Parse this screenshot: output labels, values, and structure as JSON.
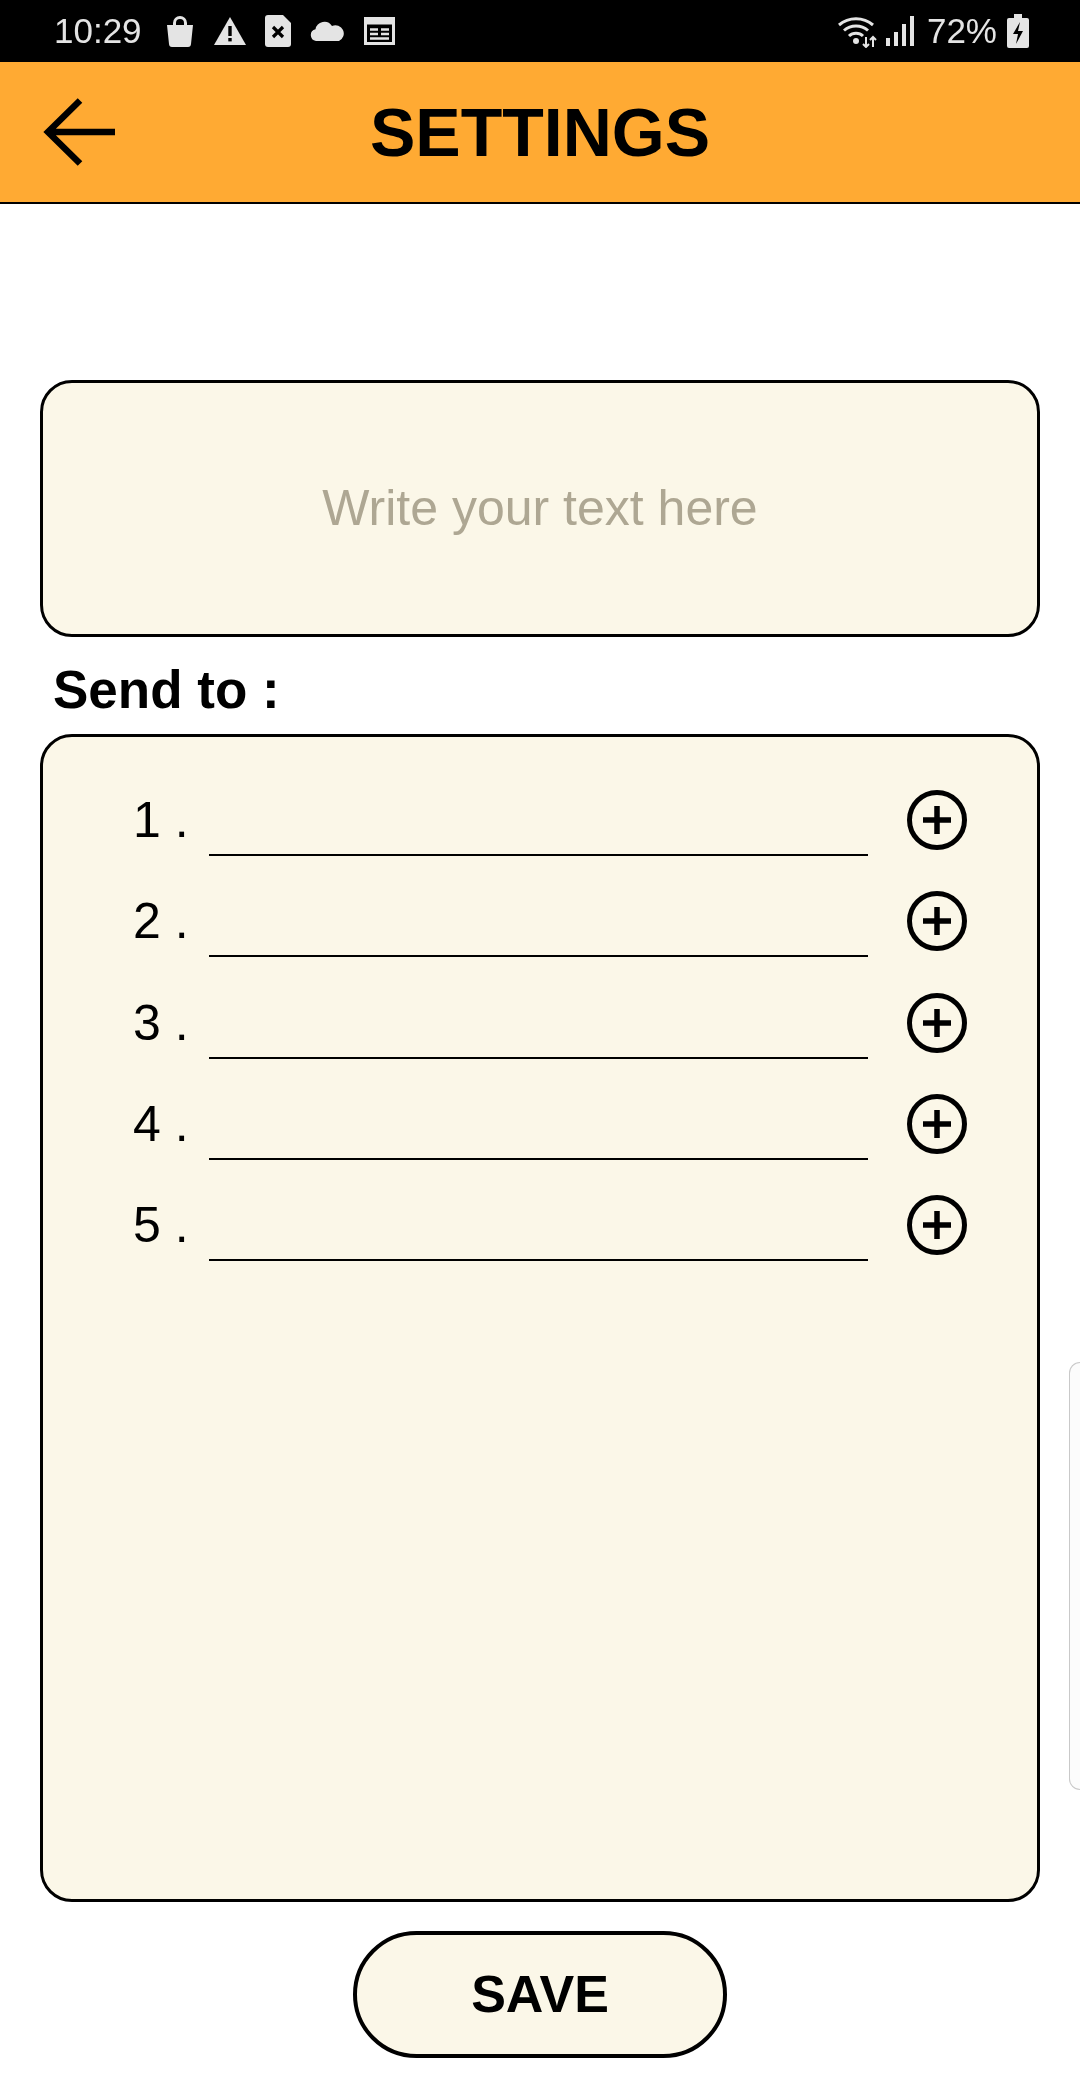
{
  "status_bar": {
    "time": "10:29",
    "battery_percent": "72%"
  },
  "toolbar": {
    "title": "SETTINGS"
  },
  "message_field": {
    "placeholder": "Write your text here"
  },
  "send_to": {
    "label": "Send to :",
    "recipients": [
      {
        "number": "1 ."
      },
      {
        "number": "2 ."
      },
      {
        "number": "3 ."
      },
      {
        "number": "4 ."
      },
      {
        "number": "5 ."
      }
    ]
  },
  "save_button": {
    "label": "SAVE"
  }
}
